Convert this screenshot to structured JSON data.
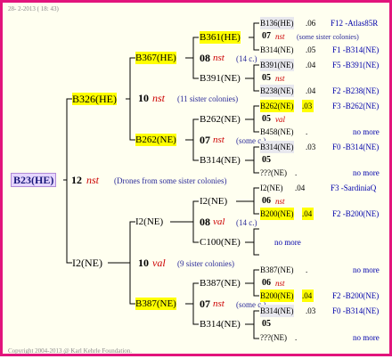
{
  "header": "28- 2-2013 ( 18: 43)",
  "footer": "Copyright 2004-2013 @ Karl Kehrle Foundation.",
  "root": {
    "id": "B23(HE)",
    "num": "12",
    "mark": "nst",
    "note": "(Drones from some sister colonies)"
  },
  "g1": {
    "top": {
      "id": "B326(HE)",
      "num": "10",
      "mark": "nst",
      "note": "(11 sister colonies)"
    },
    "bottom": {
      "id": "I2(NE)",
      "num": "10",
      "mark": "val",
      "note": "(9 sister colonies)"
    }
  },
  "g2": {
    "a": {
      "id": "B367(HE)",
      "num": "08",
      "mark": "nst",
      "note": "(14 c.)"
    },
    "b": {
      "id": "B262(NE)",
      "num": "07",
      "mark": "nst",
      "note": "(some c.)"
    },
    "c": {
      "id": "I2(NE)",
      "num": "08",
      "mark": "val",
      "note": "(14 c.)"
    },
    "d": {
      "id": "B387(NE)",
      "num": "07",
      "mark": "nst",
      "note": "(some c.)"
    }
  },
  "g3": {
    "a1": "B361(HE)",
    "a2": "B391(NE)",
    "b1": "B262(NE)",
    "b2": "B314(NE)",
    "c1": "I2(NE)",
    "c2": "C100(NE)",
    "d1": "B387(NE)",
    "d2": "B314(NE)"
  },
  "g4": [
    {
      "id": "B136(HE)",
      "num": ".06",
      "code": "F12 -Atlas85R"
    },
    {
      "id": "07",
      "mark": "nst",
      "note": "(some sister colonies)"
    },
    {
      "id": "B314(NE)",
      "num": ".05",
      "code": "F1 -B314(NE)"
    },
    {
      "id": "B391(NE)",
      "num": ".04",
      "code": "F5 -B391(NE)"
    },
    {
      "id": "05",
      "mark": "nst"
    },
    {
      "id": "B238(NE)",
      "num": ".04",
      "code": "F2 -B238(NE)"
    },
    {
      "id": "B262(NE)",
      "num": ".03",
      "code": "F3 -B262(NE)"
    },
    {
      "id": "05",
      "mark": "val"
    },
    {
      "id": "B458(NE)",
      "num": ".",
      "code": "no more"
    },
    {
      "id": "B314(NE)",
      "num": ".03",
      "code": "F0 -B314(NE)"
    },
    {
      "id": "05"
    },
    {
      "id": "???(NE)",
      "num": ".",
      "code": "no more"
    },
    {
      "id": "I2(NE)",
      "num": ".04",
      "code": "F3 -SardiniaQ"
    },
    {
      "id": "06",
      "mark": "nst"
    },
    {
      "id": "B200(NE)",
      "num": ".04",
      "code": "F2 -B200(NE)"
    },
    {
      "id": "",
      "code": "no more"
    },
    {
      "id": "B387(NE)",
      "num": ".",
      "code": "no more"
    },
    {
      "id": "06",
      "mark": "nst"
    },
    {
      "id": "B200(NE)",
      "num": ".04",
      "code": "F2 -B200(NE)"
    },
    {
      "id": "B314(NE)",
      "num": ".03",
      "code": "F0 -B314(NE)"
    },
    {
      "id": "05"
    },
    {
      "id": "???(NE)",
      "num": ".",
      "code": "no more"
    }
  ]
}
